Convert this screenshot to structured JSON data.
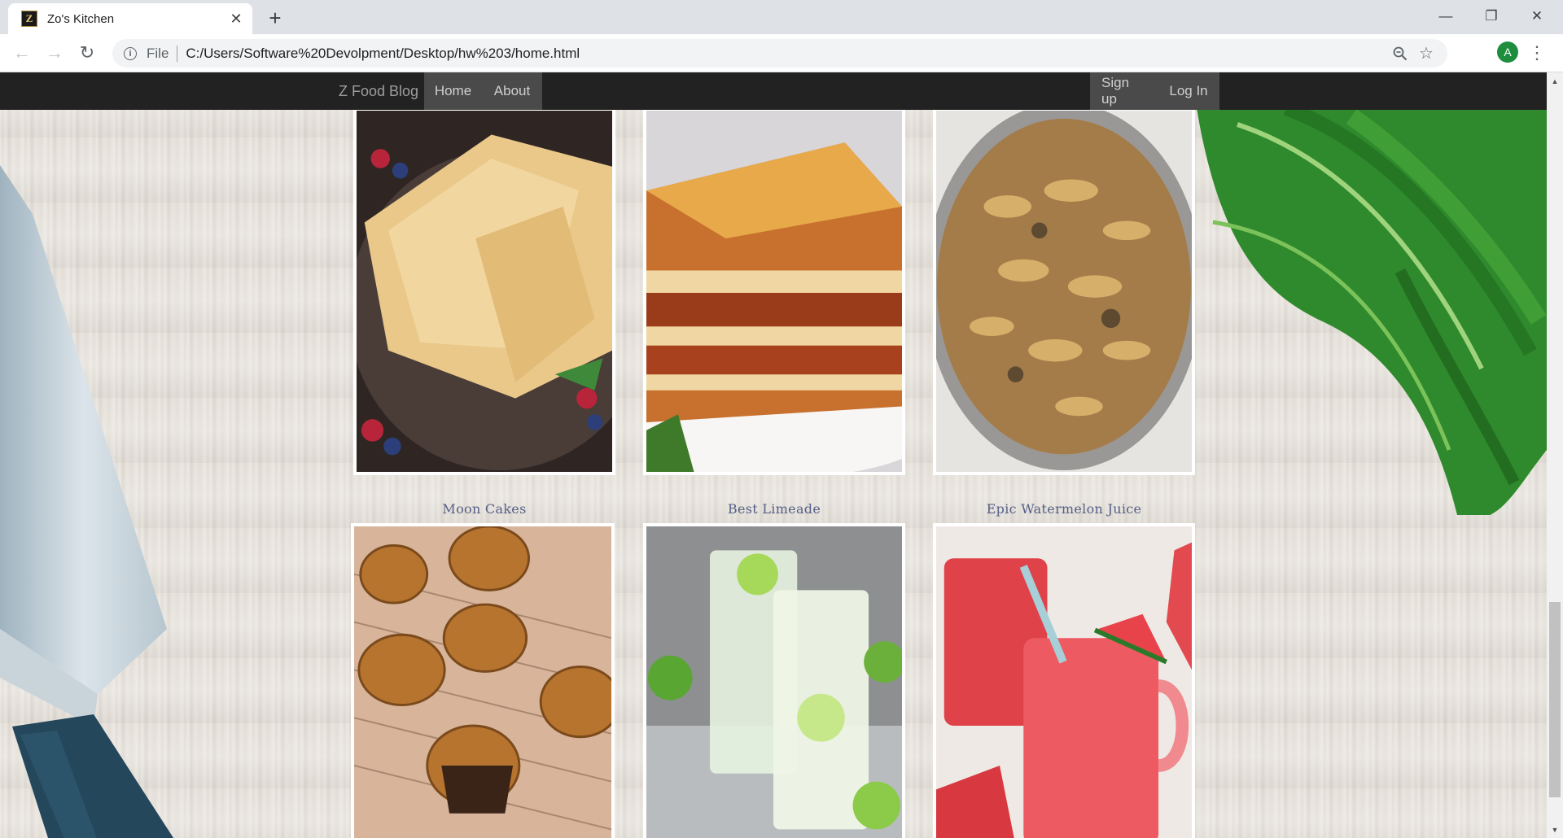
{
  "browser": {
    "tab_title": "Zo's Kitchen",
    "favicon_letter": "Z",
    "new_tab_glyph": "+",
    "url_scheme": "File",
    "url": "C:/Users/Software%20Devolpment/Desktop/hw%203/home.html",
    "profile_initial": "A",
    "icons": [
      "back-icon",
      "forward-icon",
      "reload-icon",
      "info-icon",
      "zoom-icon",
      "star-icon",
      "menu-icon"
    ]
  },
  "navbar": {
    "brand": "Z Food Blog",
    "links": [
      "Home",
      "About"
    ],
    "right_links": [
      "Sign up",
      "Log In"
    ]
  },
  "recipes": {
    "row_top": [
      {
        "caption": "",
        "image": "crepes"
      },
      {
        "caption": "",
        "image": "lasagna"
      },
      {
        "caption": "",
        "image": "beef-stroganoff"
      }
    ],
    "row_bottom": [
      {
        "caption": "Moon Cakes",
        "image": "moon-cakes"
      },
      {
        "caption": "Best Limeade",
        "image": "limeade"
      },
      {
        "caption": "Epic Watermelon Juice",
        "image": "watermelon-juice"
      }
    ]
  },
  "colors": {
    "navbar_bg": "#222222",
    "nav_active_bg": "#4a4a4a",
    "caption_color": "#555f86",
    "tabstrip_bg": "#dee1e6"
  }
}
